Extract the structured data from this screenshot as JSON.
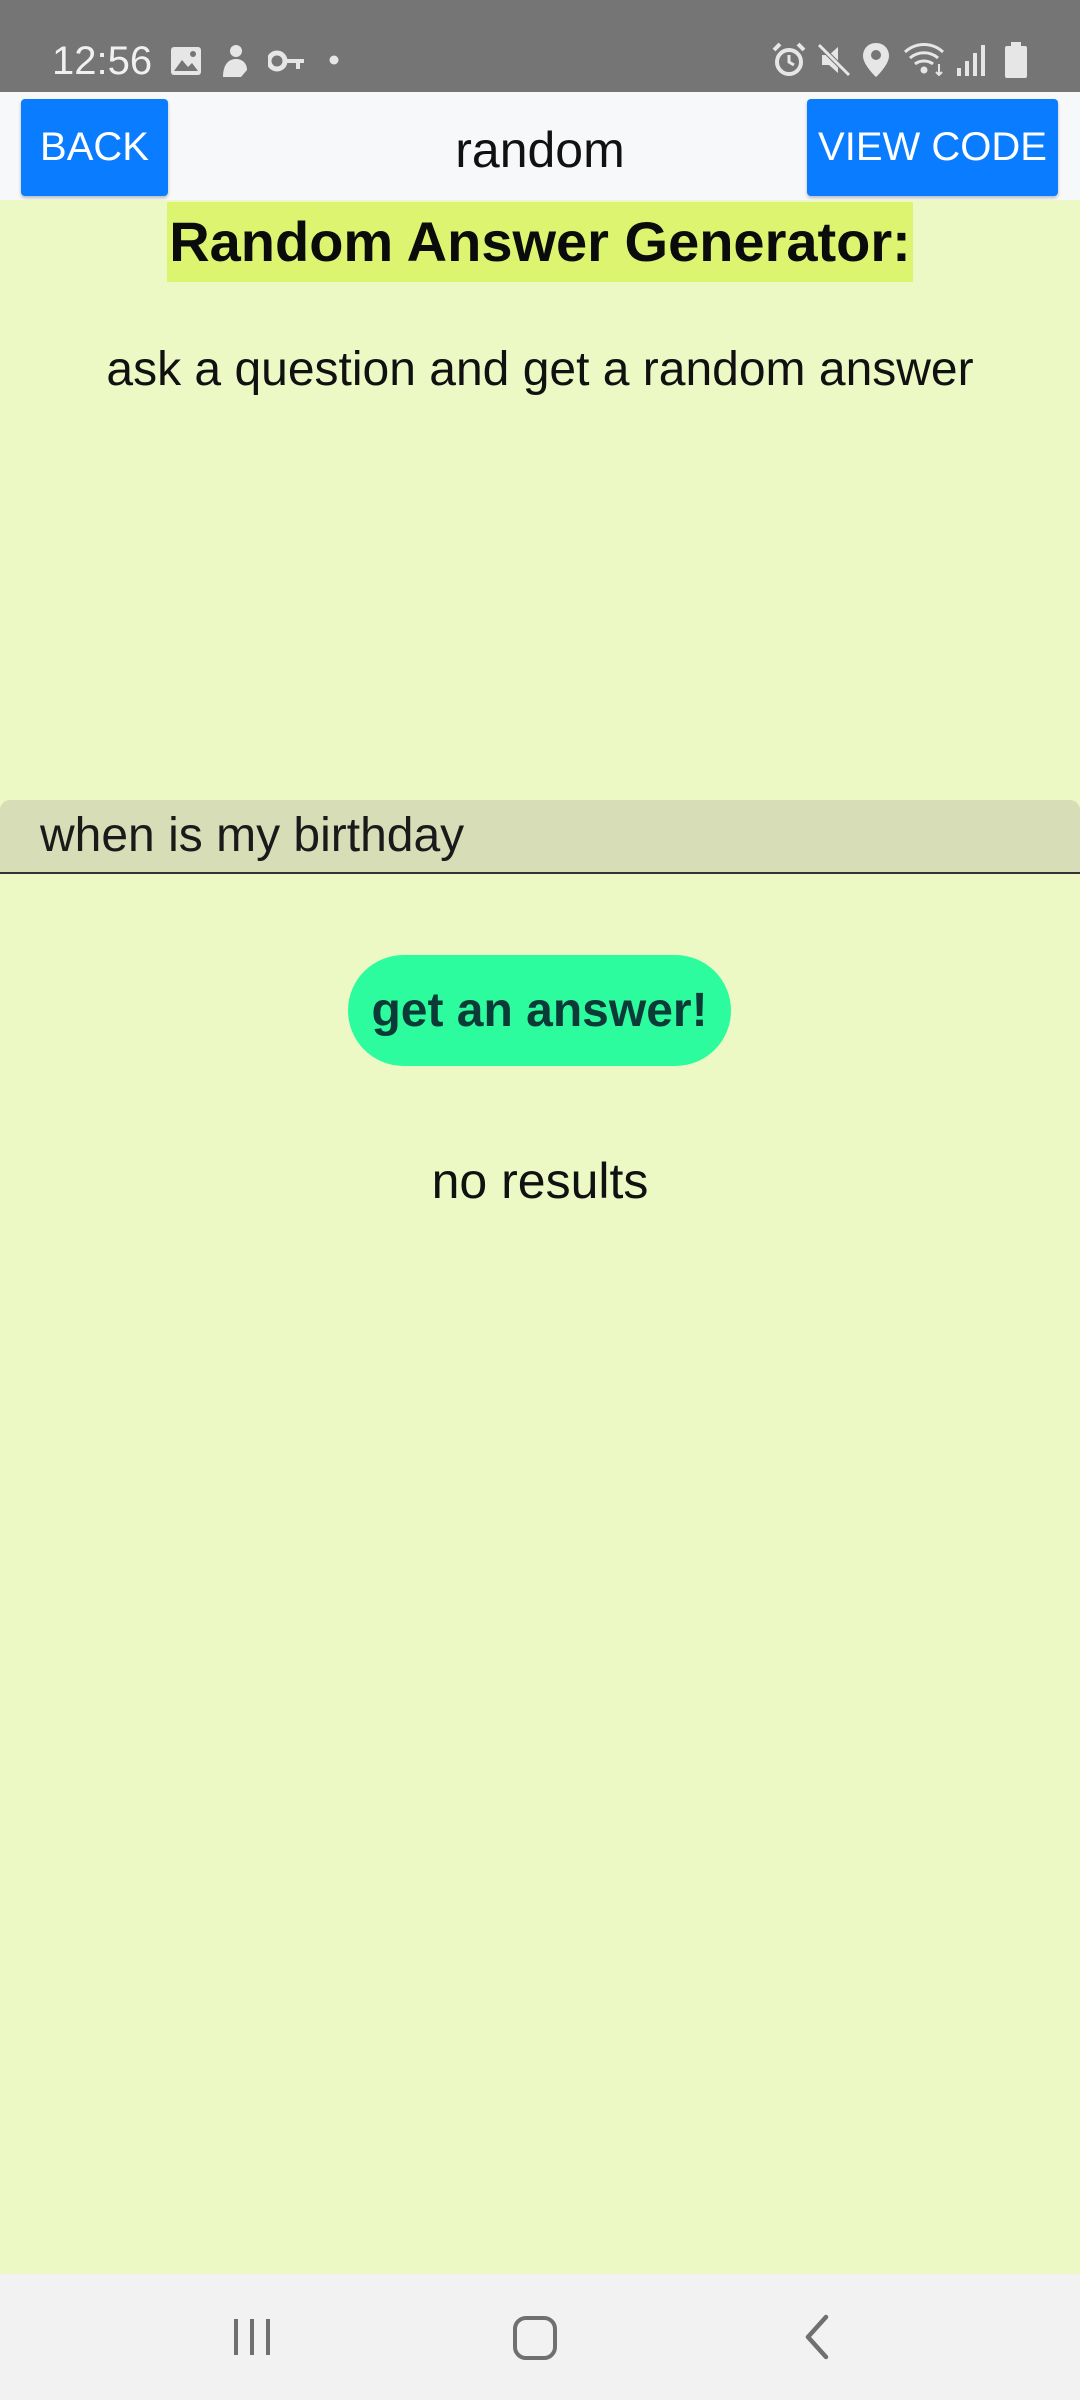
{
  "status_bar": {
    "time": "12:56",
    "left_icons": [
      "image-icon",
      "person-icon",
      "key-icon",
      "dot-icon"
    ],
    "right_icons": [
      "alarm-icon",
      "mute-icon",
      "location-icon",
      "wifi-icon",
      "signal-icon",
      "battery-icon"
    ]
  },
  "header": {
    "back_label": "BACK",
    "title": "random",
    "view_code_label": "VIEW CODE",
    "accent_color": "#0a7cff"
  },
  "main": {
    "title": "Random Answer Generator:",
    "subtitle": "ask a question and get a random answer",
    "question_value": "when is my birthday",
    "answer_button_label": "get an answer!",
    "result_text": "no results",
    "background_color": "#ecf9c4",
    "title_highlight_color": "#dcf46f",
    "button_color": "#2dfc9e"
  },
  "nav_bar": {
    "icons": [
      "recent-apps-icon",
      "home-icon",
      "back-icon"
    ]
  }
}
